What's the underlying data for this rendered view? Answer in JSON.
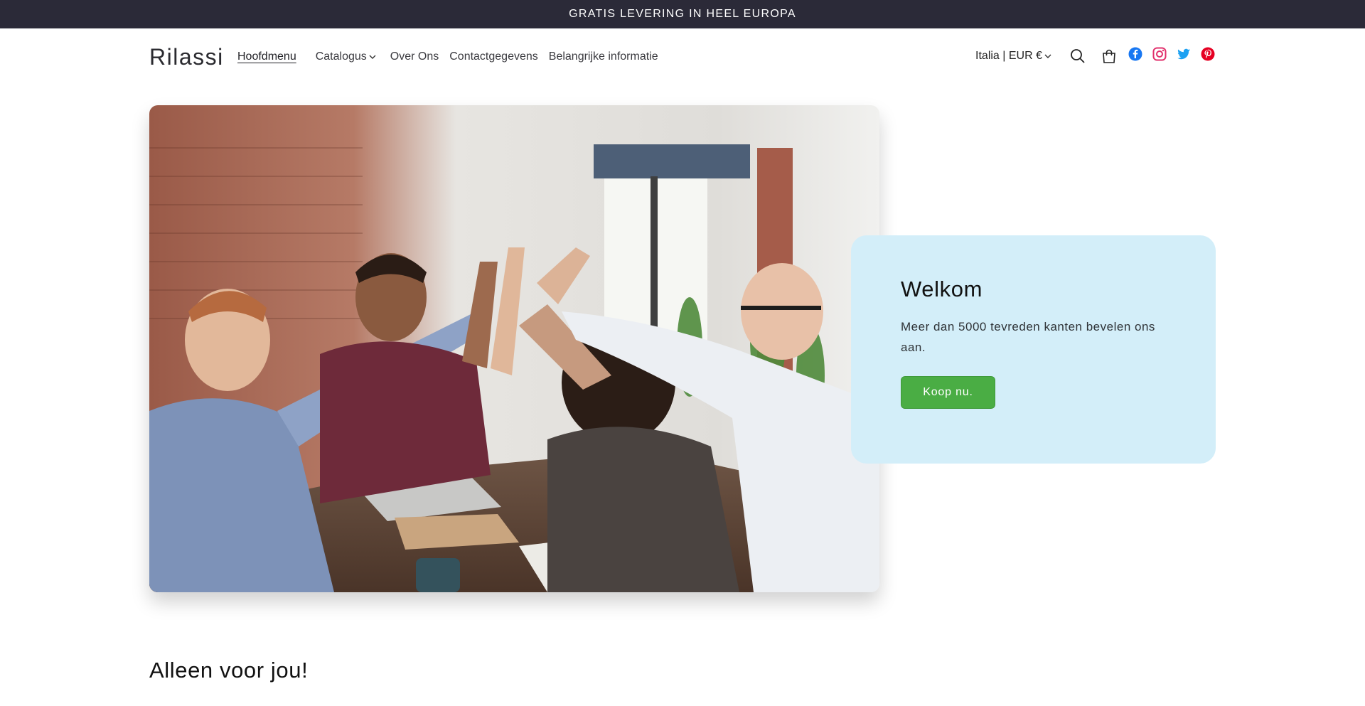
{
  "announcement": {
    "text": "GRATIS LEVERING IN HEEL EUROPA"
  },
  "header": {
    "logo": "Rilassi",
    "nav": [
      {
        "label": "Hoofdmenu",
        "active": true
      },
      {
        "label": "Catalogus",
        "has_dropdown": true
      },
      {
        "label": "Over Ons"
      },
      {
        "label": "Contactgegevens"
      },
      {
        "label": "Belangrijke informatie"
      }
    ],
    "locale": "Italia | EUR €",
    "icons": [
      "search-icon",
      "cart-icon",
      "facebook-icon",
      "instagram-icon",
      "twitter-icon",
      "pinterest-icon"
    ]
  },
  "hero": {
    "image_alt": "Team colleagues high-fiving around a table",
    "title": "Welkom",
    "text": "Meer dan 5000 tevreden kanten bevelen ons aan.",
    "button": "Koop nu."
  },
  "section": {
    "title": "Alleen voor jou!"
  },
  "colors": {
    "announcement_bg": "#2b2a38",
    "card_bg": "#d3eef9",
    "button_bg": "#4aad44",
    "facebook": "#1877f2",
    "instagram": "#e1306c",
    "twitter": "#1da1f2",
    "pinterest": "#e60023"
  }
}
